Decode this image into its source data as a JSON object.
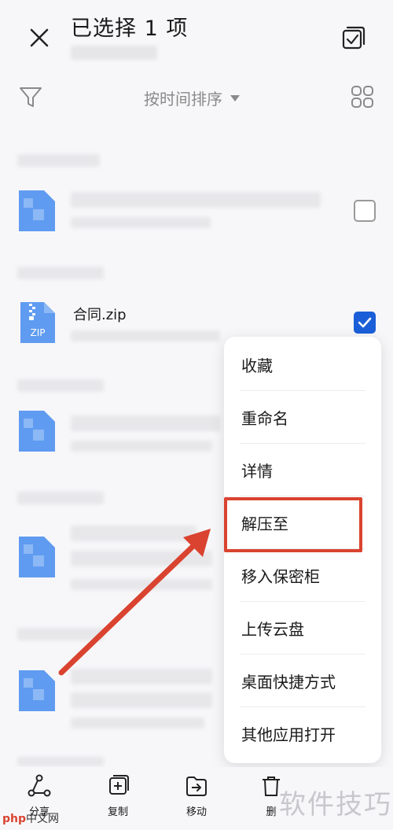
{
  "header": {
    "title": "已选择 1 项"
  },
  "toolbar": {
    "sort_label": "按时间排序"
  },
  "files": [
    {
      "name": "",
      "checked": false
    },
    {
      "name": "合同.zip",
      "icon_label": "ZIP",
      "checked": true
    },
    {
      "name": ""
    },
    {
      "name": ""
    },
    {
      "name": ""
    }
  ],
  "context_menu": {
    "items": [
      "收藏",
      "重命名",
      "详情",
      "解压至",
      "移入保密柜",
      "上传云盘",
      "桌面快捷方式",
      "其他应用打开"
    ],
    "highlighted": "解压至"
  },
  "bottom_bar": {
    "actions": [
      "分享",
      "复制",
      "移动",
      "删"
    ]
  },
  "watermarks": {
    "main": "软件技巧",
    "site_prefix": "php",
    "site_suffix": "中文网"
  },
  "colors": {
    "accent": "#1a5fd8",
    "annotation": "#d9432f",
    "file_blue": "#5f9bf0"
  }
}
